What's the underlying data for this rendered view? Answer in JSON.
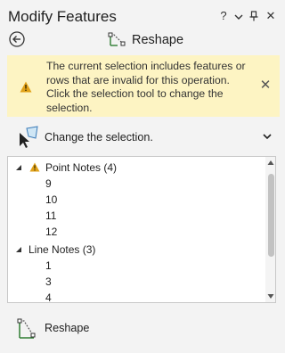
{
  "pane": {
    "title": "Modify Features",
    "help_glyph": "?",
    "options_glyph": "⌄",
    "pin_glyph": "ꟷ",
    "close_glyph": "✕"
  },
  "tool": {
    "name": "Reshape",
    "icon": "reshape-tool-icon"
  },
  "warning": {
    "message": "The current selection includes features or rows that are invalid for this operation. Click the selection tool to change the selection.",
    "close_glyph": "✕",
    "accent_color": "#e1a21a",
    "background_color": "#fdf4c3"
  },
  "selection": {
    "label": "Change the selection."
  },
  "tree": {
    "groups": [
      {
        "name": "Point Notes (4)",
        "has_warning": true,
        "items": [
          "9",
          "10",
          "11",
          "12"
        ]
      },
      {
        "name": "Line Notes (3)",
        "has_warning": false,
        "items": [
          "1",
          "3",
          "4"
        ]
      }
    ]
  },
  "bottom_tool": {
    "label": "Reshape"
  }
}
